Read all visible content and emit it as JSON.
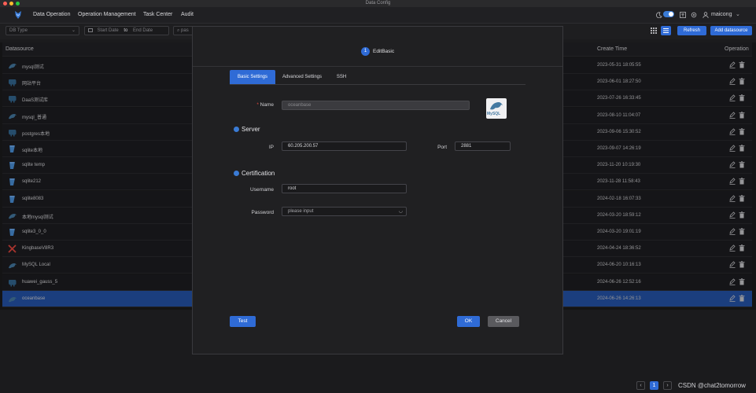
{
  "window": {
    "title": "Data Config"
  },
  "menu": {
    "items": [
      "Data Operation",
      "Operation Management",
      "Task Center",
      "Audit"
    ],
    "user": "maicong"
  },
  "filters": {
    "db_type_placeholder": "DB Type",
    "start_date": "Start Date",
    "to": "to",
    "end_date": "End Date",
    "search_value": "pas",
    "refresh": "Refresh",
    "add_datasource": "Add datasource"
  },
  "table": {
    "headers": {
      "datasource": "Datasource",
      "create_time": "Create Time",
      "operation": "Operation"
    },
    "rows": [
      {
        "name": "mysql测试",
        "time": "2023-05-31 18:05:55",
        "icon": "mysql-icon"
      },
      {
        "name": "网站平台",
        "time": "2023-06-01 18:27:50",
        "icon": "elephant-icon"
      },
      {
        "name": "DaaS测试库",
        "time": "2023-07-26 16:33:45",
        "icon": "elephant-icon"
      },
      {
        "name": "mysql_普通",
        "time": "2023-08-10 11:04:07",
        "icon": "mysql-icon"
      },
      {
        "name": "postgres本地",
        "time": "2023-09-06 15:30:52",
        "icon": "elephant-icon"
      },
      {
        "name": "sqlite本地",
        "time": "2023-09-07 14:26:19",
        "icon": "sqlite-icon"
      },
      {
        "name": "sqlite temp",
        "time": "2023-11-20 10:19:30",
        "icon": "sqlite-icon"
      },
      {
        "name": "sqlite212",
        "time": "2023-11-28 11:58:43",
        "icon": "sqlite-icon"
      },
      {
        "name": "sqlite8083",
        "time": "2024-02-18 16:07:33",
        "icon": "sqlite-icon"
      },
      {
        "name": "本地mysql测试",
        "time": "2024-03-20 18:59:12",
        "icon": "mysql-icon"
      },
      {
        "name": "sqlite3_0_0",
        "time": "2024-03-20 19:01:19",
        "icon": "sqlite-icon"
      },
      {
        "name": "KingbaseV8R3",
        "time": "2024-04-24 18:36:52",
        "icon": "kingbase-icon"
      },
      {
        "name": "MySQL Local",
        "time": "2024-06-20 10:16:13",
        "icon": "mysql-icon"
      },
      {
        "name": "huawei_gauss_5",
        "time": "2024-06-26 12:52:16",
        "icon": "elephant-icon"
      },
      {
        "name": "oceanbase",
        "time": "2024-06-26 14:26:13",
        "icon": "mysql-icon"
      }
    ]
  },
  "modal": {
    "step_number": "1",
    "step_label": "EditBasic",
    "tabs": [
      "Basic Settings",
      "Advanced Settings",
      "SSH"
    ],
    "name_label": "Name",
    "name_value": "oceanbase",
    "server_section": "Server",
    "ip_label": "IP",
    "ip_value": "60.205.200.57",
    "port_label": "Port",
    "port_value": "2881",
    "cert_section": "Certification",
    "username_label": "Username",
    "username_value": "root",
    "password_label": "Password",
    "password_placeholder": "please input",
    "test_button": "Test",
    "ok_button": "OK",
    "cancel_button": "Cancel",
    "logo_text": "MySQL"
  },
  "pagination": {
    "prev": "‹",
    "page": "1",
    "next": "›"
  },
  "watermark": "CSDN @chat2tomorrow",
  "colors": {
    "accent": "#2f6bd6",
    "selected_row": "#2453a8",
    "background": "#1b1b1d"
  }
}
